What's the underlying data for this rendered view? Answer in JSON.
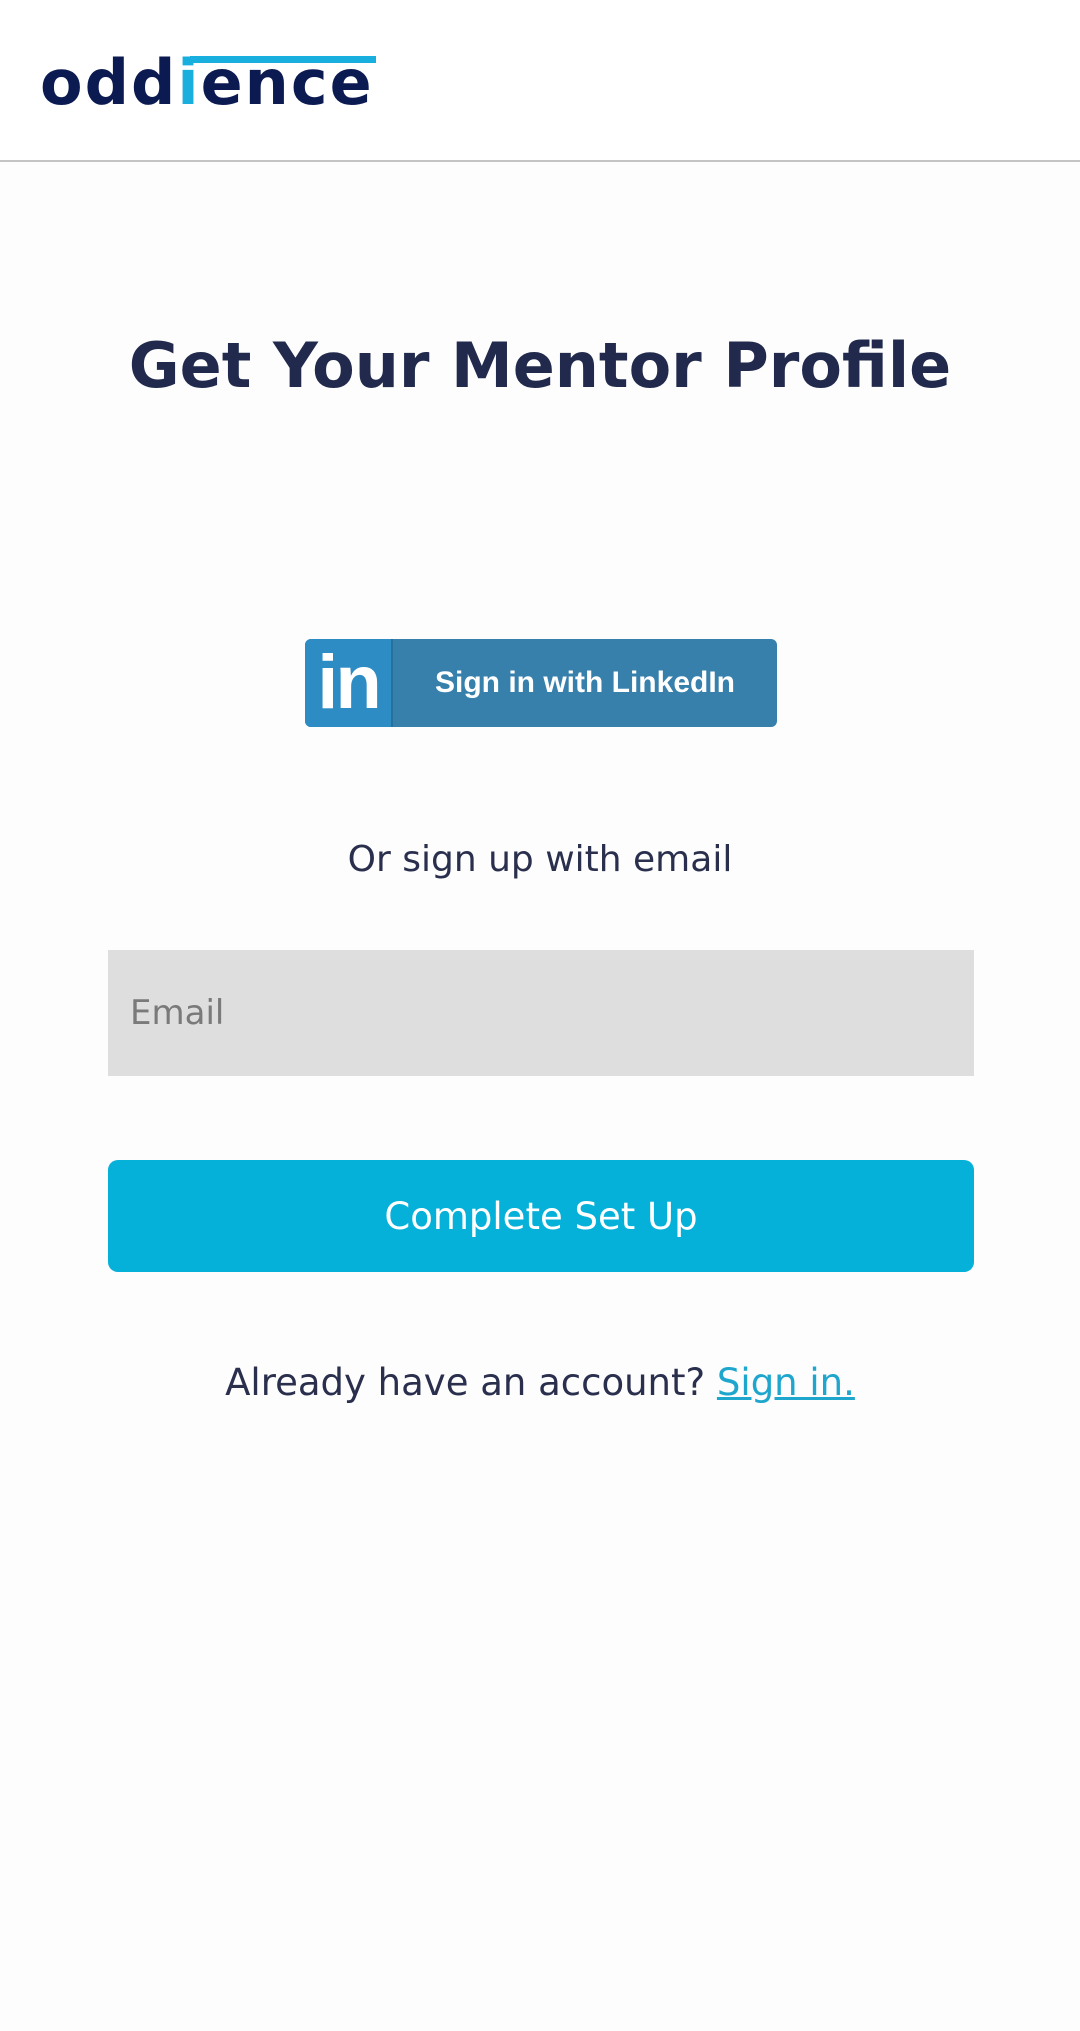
{
  "header": {
    "logo": {
      "part1": "odd",
      "accent": "i",
      "part2": "ence",
      "brand_color": "#0c1a52",
      "accent_color": "#18aede"
    }
  },
  "main": {
    "title": "Get Your Mentor Profile",
    "linkedin": {
      "icon": "linkedin-icon",
      "icon_text": "in",
      "label": "Sign in with LinkedIn",
      "color": "#3780ac"
    },
    "divider_text": "Or sign up with email",
    "email": {
      "placeholder": "Email",
      "value": ""
    },
    "submit_label": "Complete Set Up",
    "submit_color": "#05b0d9",
    "signin": {
      "prompt": "Already have an account?",
      "link_label": "Sign in."
    }
  }
}
